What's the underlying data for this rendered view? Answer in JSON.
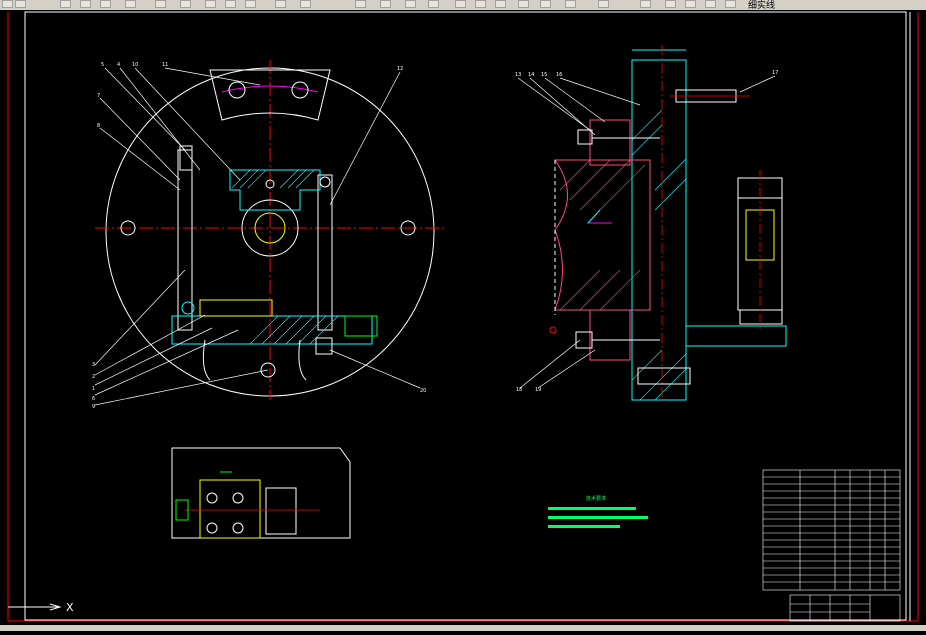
{
  "toolbar": {
    "layer_label": "细实线"
  },
  "drawing": {
    "callouts_front": [
      "5",
      "4",
      "10",
      "11",
      "7",
      "8",
      "12",
      "3",
      "2",
      "1",
      "6",
      "9",
      "20"
    ],
    "callouts_side": [
      "13",
      "14",
      "15",
      "16",
      "17",
      "18",
      "19"
    ],
    "tech_title": "技术要求",
    "colors": {
      "background": "#000000",
      "outline": "#ffffff",
      "center": "#ff0000",
      "hatch": "#00ffff",
      "section": "#ff4a7d",
      "dim": "#00ff00",
      "green": "#00ff66",
      "magenta": "#ff00ff",
      "yellow": "#ffff00",
      "border_red": "#ff0000"
    }
  },
  "axis": {
    "icon_x": "X"
  }
}
